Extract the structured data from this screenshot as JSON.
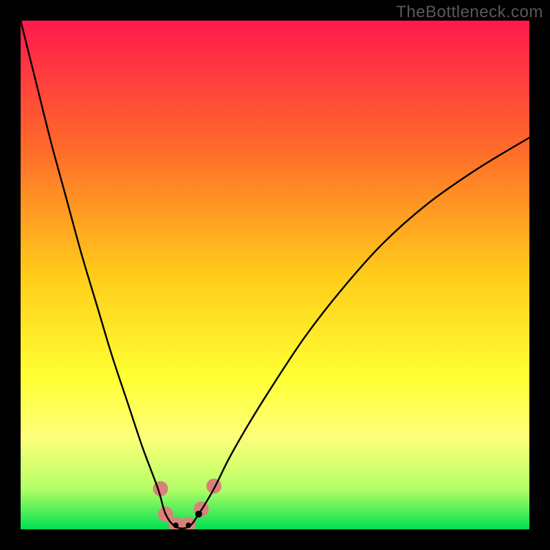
{
  "watermark": "TheBottleneck.com",
  "chart_data": {
    "type": "line",
    "title": "",
    "xlabel": "",
    "ylabel": "",
    "xlim": [
      0,
      100
    ],
    "ylim": [
      0,
      100
    ],
    "grid": false,
    "axes_visible": false,
    "background_gradient": [
      {
        "offset": 0.0,
        "color": "#ff1a4d"
      },
      {
        "offset": 0.25,
        "color": "#ff6a2a"
      },
      {
        "offset": 0.5,
        "color": "#ffcc1a"
      },
      {
        "offset": 0.7,
        "color": "#ffff33"
      },
      {
        "offset": 0.82,
        "color": "#fdff7a"
      },
      {
        "offset": 0.92,
        "color": "#b4ff66"
      },
      {
        "offset": 1.0,
        "color": "#00e050"
      }
    ],
    "series": [
      {
        "name": "bottleneck-curve",
        "color": "#000000",
        "x": [
          0,
          3,
          6,
          9,
          12,
          15,
          18,
          21,
          24,
          27,
          28.5,
          30.5,
          33,
          35,
          38,
          41,
          45,
          50,
          56,
          63,
          71,
          80,
          90,
          100
        ],
        "y": [
          100,
          88,
          76,
          65,
          54,
          44,
          34,
          25,
          16,
          8,
          3,
          0.5,
          0.5,
          3,
          8,
          14,
          21,
          29,
          38,
          47,
          56,
          64,
          71,
          77
        ]
      }
    ],
    "markers": [
      {
        "x": 27.5,
        "y": 8.0,
        "color": "#d8817b",
        "r": 11
      },
      {
        "x": 28.5,
        "y": 3.0,
        "color": "#d8817b",
        "r": 11
      },
      {
        "x": 30.5,
        "y": 1.0,
        "color": "#d8817b",
        "r": 11
      },
      {
        "x": 33.0,
        "y": 1.0,
        "color": "#d8817b",
        "r": 11
      },
      {
        "x": 35.5,
        "y": 4.0,
        "color": "#d8817b",
        "r": 11
      },
      {
        "x": 38.0,
        "y": 8.5,
        "color": "#d8817b",
        "r": 11
      }
    ],
    "black_dots": [
      {
        "x": 30.5,
        "y": 0.8,
        "r": 4
      },
      {
        "x": 33.0,
        "y": 0.8,
        "r": 4
      },
      {
        "x": 35.0,
        "y": 3.0,
        "r": 5
      }
    ]
  }
}
